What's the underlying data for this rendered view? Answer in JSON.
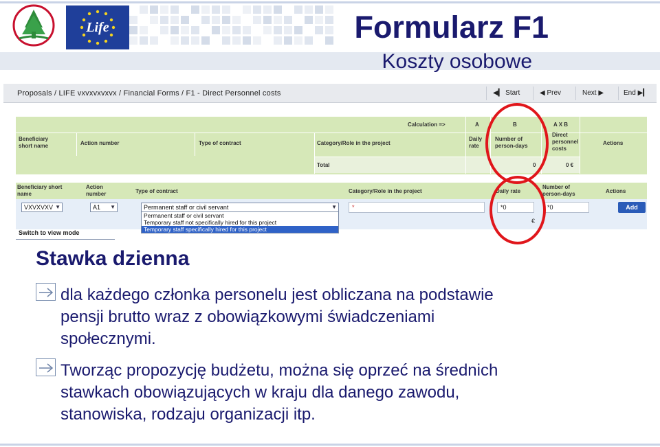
{
  "header": {
    "title": "Formularz F1",
    "subtitle": "Koszty osobowe",
    "life_logo_text": "Life"
  },
  "screenshot": {
    "breadcrumb": "Proposals / LIFE vxvxvxvxvx / Financial Forms / F1 - Direct Personnel costs",
    "nav": {
      "start": "Start",
      "prev": "Prev",
      "next": "Next",
      "end": "End"
    },
    "calc_label": "Calculation =>",
    "col_a": "A",
    "col_b": "B",
    "col_axb": "A X B",
    "headers1": {
      "beneficiary": [
        "Beneficiary",
        "short name"
      ],
      "action_number": "Action number",
      "type_of_contract": "Type of contract",
      "category": "Category/Role in the project",
      "daily_rate": [
        "Daily",
        "rate"
      ],
      "person_days": [
        "Number of",
        "person-days"
      ],
      "direct_costs": [
        "Direct",
        "personnel",
        "costs"
      ],
      "actions": "Actions"
    },
    "total": {
      "label": "Total",
      "person_days": "0",
      "costs": "0 €"
    },
    "headers2": {
      "beneficiary": [
        "Beneficiary short",
        "name"
      ],
      "action": [
        "Action",
        "number"
      ],
      "type_of_contract": "Type of contract",
      "category": "Category/Role in the project",
      "daily_rate": "Daily rate",
      "person_days": [
        "Number of",
        "person-days"
      ],
      "actions": "Actions"
    },
    "form": {
      "beneficiary_value": "VXVXVXV",
      "action_value": "A1",
      "contract_value": "Permanent staff or civil servant",
      "category_value": "*",
      "daily_rate_value": "*0",
      "person_days_value": "*0",
      "euro_sign": "€",
      "add_label": "Add"
    },
    "contract_options": [
      "Permanent staff or civil servant",
      "Temporary staff not specifically hired for this project",
      "Temporary staff specifically hired for this project"
    ],
    "switch_label": "Switch to view mode"
  },
  "content": {
    "heading": "Stawka dzienna",
    "bullets": [
      [
        "dla każdego członka personelu jest obliczana na podstawie",
        "pensji brutto wraz z obowiązkowymi świadczeniami",
        "społecznymi."
      ],
      [
        "Tworząc propozycję budżetu, można się oprzeć na średnich",
        "stawkach obowiązujących w kraju dla danego zawodu,",
        "stanowiska, rodzaju organizacji itp."
      ]
    ]
  },
  "colors": {
    "title": "#1a1a6e",
    "highlight_ring": "#e0161b",
    "table_header": "#d6e8b8",
    "add_button": "#2a5bb8"
  }
}
